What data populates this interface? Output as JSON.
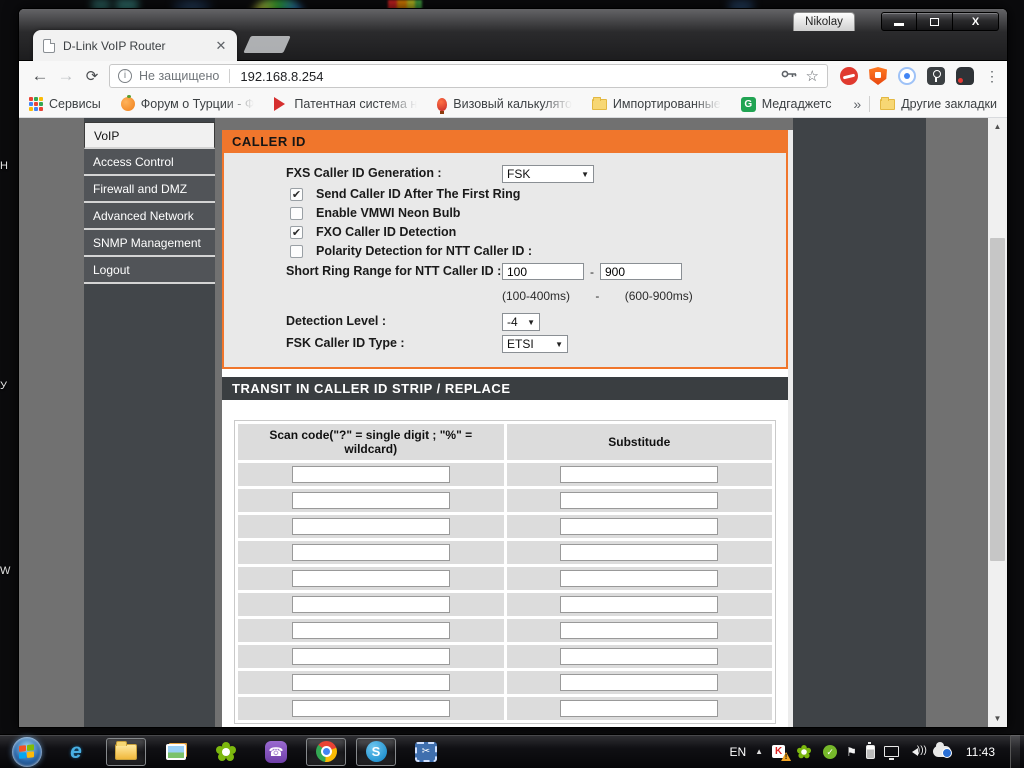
{
  "window": {
    "profile_button": "Nikolay",
    "tab": {
      "title": "D-Link VoIP Router"
    },
    "address_bar": {
      "security_text": "Не защищено",
      "url": "192.168.8.254"
    },
    "bookmarks": {
      "items": [
        {
          "label": "Сервисы"
        },
        {
          "label": "Форум о Турции - Ф"
        },
        {
          "label": "Патентная система н"
        },
        {
          "label": "Визовый калькулято"
        },
        {
          "label": "Импортированные"
        },
        {
          "label": "Медгаджетс"
        }
      ],
      "overflow_chevron": "»",
      "other_bookmarks": "Другие закладки"
    }
  },
  "page": {
    "sidebar": {
      "items": [
        {
          "label": "VoIP",
          "selected": true
        },
        {
          "label": "Access Control",
          "selected": false
        },
        {
          "label": "Firewall and DMZ",
          "selected": false
        },
        {
          "label": "Advanced Network",
          "selected": false
        },
        {
          "label": "SNMP Management",
          "selected": false
        },
        {
          "label": "Logout",
          "selected": false
        }
      ]
    },
    "caller_id": {
      "title": "CALLER ID",
      "fxs_label": "FXS Caller ID Generation :",
      "fxs_value": "FSK",
      "checkboxes": [
        {
          "label": "Send Caller ID After The First Ring",
          "checked": true
        },
        {
          "label": "Enable VMWI Neon Bulb",
          "checked": false
        },
        {
          "label": "FXO Caller ID Detection",
          "checked": true
        },
        {
          "label": "Polarity Detection for NTT Caller ID :",
          "checked": false
        }
      ],
      "short_ring_label": "Short Ring Range for NTT Caller ID :",
      "short_ring_min": "100",
      "short_ring_max": "900",
      "range_hint_min": "(100-400ms)",
      "range_hint_sep": "-",
      "range_hint_max": "(600-900ms)",
      "detection_label": "Detection Level :",
      "detection_value": "-4",
      "fsk_type_label": "FSK Caller ID Type :",
      "fsk_type_value": "ETSI"
    },
    "transit": {
      "title": "TRANSIT IN CALLER ID STRIP / REPLACE",
      "col_scan": "Scan code(\"?\" = single digit ; \"%\" = wildcard)",
      "col_substitute": "Substitude",
      "rows": [
        {
          "scan": "",
          "substitute": ""
        },
        {
          "scan": "",
          "substitute": ""
        },
        {
          "scan": "",
          "substitute": ""
        },
        {
          "scan": "",
          "substitute": ""
        },
        {
          "scan": "",
          "substitute": ""
        },
        {
          "scan": "",
          "substitute": ""
        },
        {
          "scan": "",
          "substitute": ""
        },
        {
          "scan": "",
          "substitute": ""
        },
        {
          "scan": "",
          "substitute": ""
        },
        {
          "scan": "",
          "substitute": ""
        }
      ]
    }
  },
  "taskbar": {
    "tray": {
      "language": "EN",
      "time": "11:43"
    }
  },
  "colors": {
    "accent_orange": "#f0762c",
    "section_dark": "#3a3e41",
    "sidebar_dark": "#515458",
    "page_gray": "#717171"
  }
}
